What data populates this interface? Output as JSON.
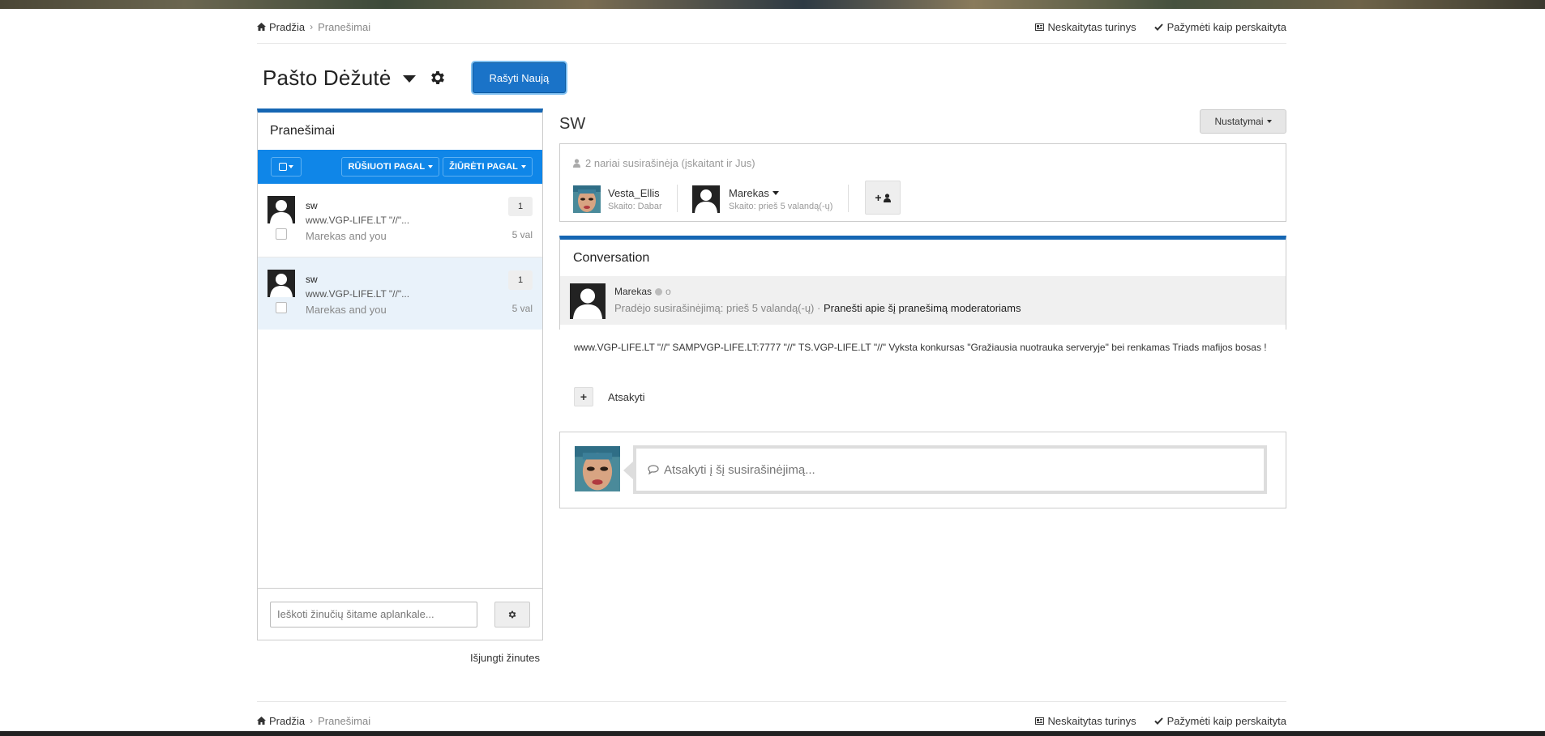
{
  "breadcrumb": {
    "home": "Pradžia",
    "current": "Pranešimai"
  },
  "top_actions": {
    "unread": "Neskaitytas turinys",
    "mark_read": "Pažymėti kaip perskaityta"
  },
  "header": {
    "title": "Pašto Dėžutė",
    "compose": "Rašyti Naują"
  },
  "list": {
    "title": "Pranešimai",
    "sort": "RŪŠIUOTI PAGAL",
    "filter": "ŽIŪRĖTI PAGAL",
    "items": [
      {
        "name": "sw",
        "preview": "www.VGP-LIFE.LT \"//\"...",
        "members": "Marekas and you",
        "count": "1",
        "time": "5 val"
      },
      {
        "name": "sw",
        "preview": "www.VGP-LIFE.LT \"//\"...",
        "members": "Marekas and you",
        "count": "1",
        "time": "5 val"
      }
    ],
    "search_placeholder": "Ieškoti žinučių šitame aplankale...",
    "disable": "Išjungti žinutes"
  },
  "conversation": {
    "title": "SW",
    "settings": "Nustatymai",
    "participant_count": "2 nariai susirašinėja (įskaitant ir Jus)",
    "participants": [
      {
        "name": "Vesta_Ellis",
        "status": "Skaito: Dabar"
      },
      {
        "name": "Marekas",
        "status": "Skaito: prieš 5 valandą(-ų)"
      }
    ],
    "heading": "Conversation",
    "author": "Marekas",
    "author_suffix": "o",
    "started": "Pradėjo susirašinėjimą: prieš 5 valandą(-ų) ·",
    "report": "Pranešti apie šį pranešimą moderatoriams",
    "body": "www.VGP-LIFE.LT \"//\" SAMPVGP-LIFE.LT:7777 \"//\" TS.VGP-LIFE.LT \"//\" Vyksta konkursas \"Gražiausia nuotrauka serveryje\" bei renkamas Triads mafijos bosas !",
    "reply": "Atsakyti",
    "reply_placeholder": "Atsakyti į šį susirašinėjimą..."
  },
  "colors": {
    "accent": "#1566b3",
    "toolbar": "#0f86e8",
    "compose": "#1a73c8"
  }
}
